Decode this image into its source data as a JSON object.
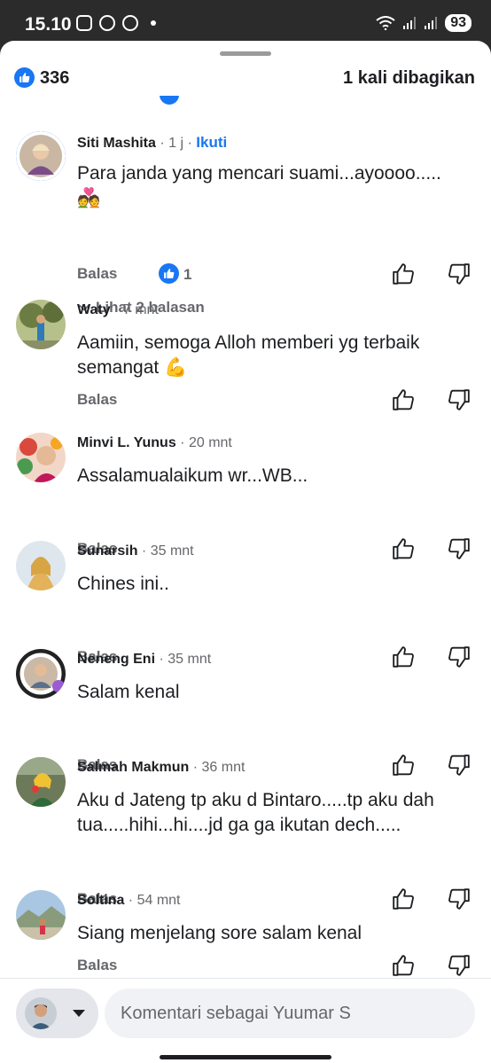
{
  "status_bar": {
    "time": "15.10",
    "battery": "93"
  },
  "header": {
    "like_count": "336",
    "share_text": "1 kali dibagikan"
  },
  "comments": [
    {
      "author": "Siti Mashita",
      "time": "1 j",
      "follow_label": "Ikuti",
      "text": "Para janda yang mencari suami...ayoooo.....",
      "emoji": "💑",
      "reply_label": "Balas",
      "reaction_count": "1",
      "view_replies": "Lihat 2 balasan"
    },
    {
      "author": "Waty",
      "time": "7 mnt",
      "text": "Aamiin, semoga Alloh memberi yg terbaik semangat 💪",
      "reply_label": "Balas"
    },
    {
      "author": "Minvi L. Yunus",
      "time": "20 mnt",
      "text": "Assalamualaikum wr...WB...",
      "reply_label": "Balas"
    },
    {
      "author": "Sunarsih",
      "time": "35 mnt",
      "text": "Chines ini..",
      "reply_label": "Balas"
    },
    {
      "author": "Neneng Eni",
      "time": "35 mnt",
      "text": "Salam kenal",
      "reply_label": "Balas"
    },
    {
      "author": "Salmah Makmun",
      "time": "36 mnt",
      "text": "Aku d Jateng tp aku d Bintaro.....tp aku dah tua.....hihi...hi....jd ga ga ikutan dech.....",
      "reply_label": "Balas"
    },
    {
      "author": "Soltina",
      "time": "54 mnt",
      "text": "Siang menjelang sore salam kenal",
      "reply_label": "Balas"
    }
  ],
  "composer": {
    "placeholder": "Komentari sebagai Yuumar S"
  },
  "colors": {
    "accent": "#1877f2",
    "muted_text": "#65676b"
  },
  "icons": [
    "like-icon",
    "thumbs-up-outline-icon",
    "thumbs-down-outline-icon",
    "chevron-down-icon",
    "caret-down-icon",
    "wifi-icon",
    "signal-icon"
  ]
}
